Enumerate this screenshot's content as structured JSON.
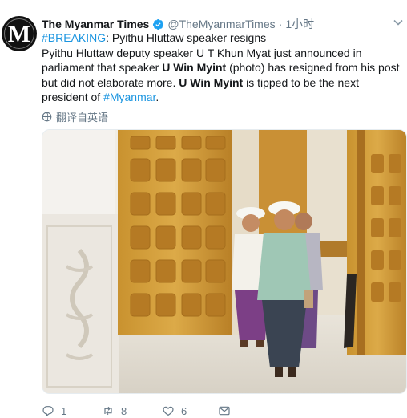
{
  "tweet": {
    "author_name": "The Myanmar Times",
    "handle": "@TheMyanmarTimes",
    "separator": "·",
    "time": "1小时",
    "line1_hashtag": "#BREAKING",
    "line1_rest": ": Pyithu Hluttaw speaker resigns",
    "line2_a": "Pyithu Hluttaw deputy speaker U T Khun Myat just announced in parliament that speaker ",
    "line2_bold": "U Win Myint",
    "line2_b": " (photo) has resigned from his post but did not elaborate more. ",
    "line2_bold2": "U Win Myint",
    "line2_c": " is tipped to be the next president of ",
    "line2_hashtag": "#Myanmar",
    "line2_end": ".",
    "translate_label": "翻译自英语",
    "avatar_letter": "M"
  },
  "actions": {
    "reply_count": "1",
    "retweet_count": "8",
    "like_count": "6"
  },
  "colors": {
    "link": "#1b95e0",
    "muted": "#657786",
    "verified": "#1da1f2"
  }
}
